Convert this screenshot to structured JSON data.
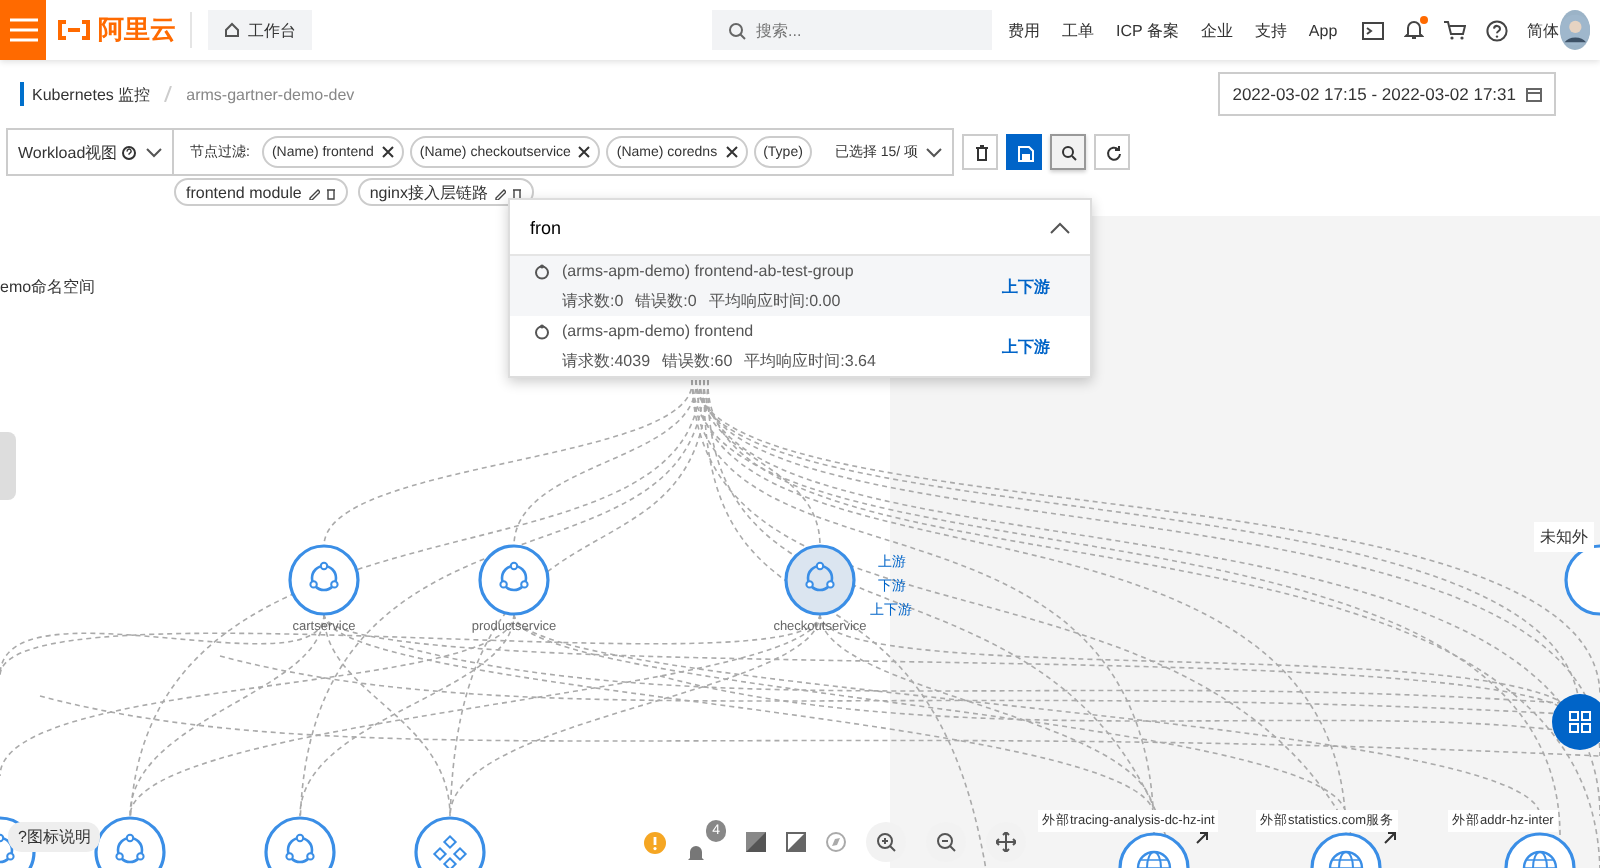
{
  "header": {
    "logo": "阿里云",
    "workbench": "工作台",
    "search": {
      "placeholder": "搜索..."
    },
    "nav": [
      "费用",
      "工单",
      "ICP 备案",
      "企业",
      "支持",
      "App"
    ],
    "notification_dot": true,
    "language": "简体"
  },
  "breadcrumb": [
    "Kubernetes 监控",
    "arms-gartner-demo-dev"
  ],
  "time_range": "2022-03-02 17:15 - 2022-03-02 17:31",
  "toolbar": {
    "view": "Workload视图",
    "filter_label": "节点过滤:",
    "filter_tags": [
      {
        "label": "(Name) frontend",
        "removable": true
      },
      {
        "label": "(Name) checkoutservice",
        "removable": true
      },
      {
        "label": "(Name) coredns",
        "removable": true
      },
      {
        "label": "(Type)",
        "removable": false
      }
    ],
    "selection": "已选择 15/ 项",
    "buttons": [
      {
        "kind": "delete",
        "selected": false
      },
      {
        "kind": "save",
        "selected": false
      },
      {
        "kind": "search",
        "selected": true
      },
      {
        "kind": "refresh",
        "selected": false
      }
    ]
  },
  "saved_filters": [
    {
      "label": "frontend module"
    },
    {
      "label": "nginx接入层链路"
    }
  ],
  "search_dropdown": {
    "value": "fron",
    "expanded": true,
    "options": [
      {
        "name": "(arms-apm-demo) frontend-ab-test-group",
        "stats": [
          "请求数:0",
          "错误数:0",
          "平均响应时间:0.00"
        ],
        "link": "上下游",
        "highlighted": true
      },
      {
        "name": "(arms-apm-demo) frontend",
        "stats": [
          "请求数:4039",
          "错误数:60",
          "平均响应时间:3.64"
        ],
        "link": "上下游",
        "highlighted": false
      }
    ]
  },
  "topology": {
    "namespace": "emo命名空间",
    "nodes": [
      {
        "label": "cartservice",
        "selected": false
      },
      {
        "label": "productservice",
        "selected": false
      },
      {
        "label": "checkoutservice",
        "selected": true
      }
    ],
    "node_actions": [
      "上游",
      "下游",
      "上下游"
    ],
    "unknown_group": "未知外",
    "bottom_nodes": [
      {
        "kind": "service"
      },
      {
        "kind": "service"
      },
      {
        "kind": "service"
      },
      {
        "kind": "cluster"
      }
    ],
    "external_nodes": [
      {
        "label": "外部tracing-analysis-dc-hz-int"
      },
      {
        "label": "外部statistics.com服务"
      },
      {
        "label": "外部addr-hz-inter"
      }
    ],
    "legend": "?图标说明",
    "alert_count": "4"
  }
}
